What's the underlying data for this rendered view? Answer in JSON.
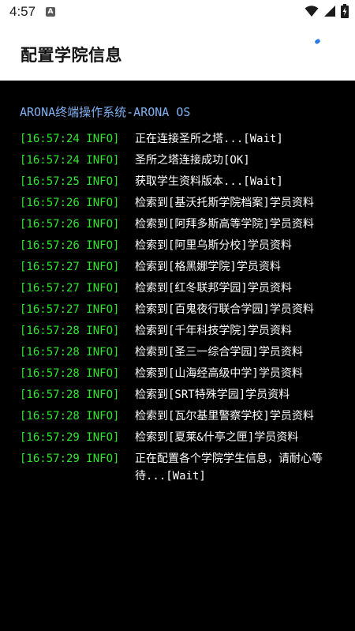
{
  "status_bar": {
    "time": "4:57",
    "notification_icon": "a-letter-icon",
    "icons": [
      "wifi-icon",
      "cellular-signal-icon",
      "battery-charging-icon"
    ]
  },
  "header": {
    "title": "配置学院信息",
    "loading_indicator_color": "#2a7be4"
  },
  "terminal": {
    "title": "ARONA终端操作系统-ARONA OS",
    "prefix_color": "#2ee82e",
    "message_color": "#ffffff",
    "title_color": "#7fb0f0",
    "logs": [
      {
        "prefix": "[16:57:24 INFO]",
        "message": "正在连接圣所之塔...[Wait]"
      },
      {
        "prefix": "[16:57:24 INFO]",
        "message": "圣所之塔连接成功[OK]"
      },
      {
        "prefix": "[16:57:25 INFO]",
        "message": "获取学生资料版本...[Wait]"
      },
      {
        "prefix": "[16:57:26 INFO]",
        "message": "检索到[基沃托斯学院档案]学员资料"
      },
      {
        "prefix": "[16:57:26 INFO]",
        "message": "检索到[阿拜多斯高等学院]学员资料"
      },
      {
        "prefix": "[16:57:26 INFO]",
        "message": "检索到[阿里乌斯分校]学员资料"
      },
      {
        "prefix": "[16:57:27 INFO]",
        "message": "检索到[格黑娜学院]学员资料"
      },
      {
        "prefix": "[16:57:27 INFO]",
        "message": "检索到[红冬联邦学园]学员资料"
      },
      {
        "prefix": "[16:57:27 INFO]",
        "message": "检索到[百鬼夜行联合学园]学员资料"
      },
      {
        "prefix": "[16:57:28 INFO]",
        "message": "检索到[千年科技学院]学员资料"
      },
      {
        "prefix": "[16:57:28 INFO]",
        "message": "检索到[圣三一综合学园]学员资料"
      },
      {
        "prefix": "[16:57:28 INFO]",
        "message": "检索到[山海经高级中学]学员资料"
      },
      {
        "prefix": "[16:57:28 INFO]",
        "message": "检索到[SRT特殊学园]学员资料"
      },
      {
        "prefix": "[16:57:28 INFO]",
        "message": "检索到[瓦尔基里警察学校]学员资料"
      },
      {
        "prefix": "[16:57:29 INFO]",
        "message": "检索到[夏莱&什亭之匣]学员资料"
      },
      {
        "prefix": "[16:57:29 INFO]",
        "message": "正在配置各个学院学生信息，请耐心等待...[Wait]"
      }
    ]
  }
}
